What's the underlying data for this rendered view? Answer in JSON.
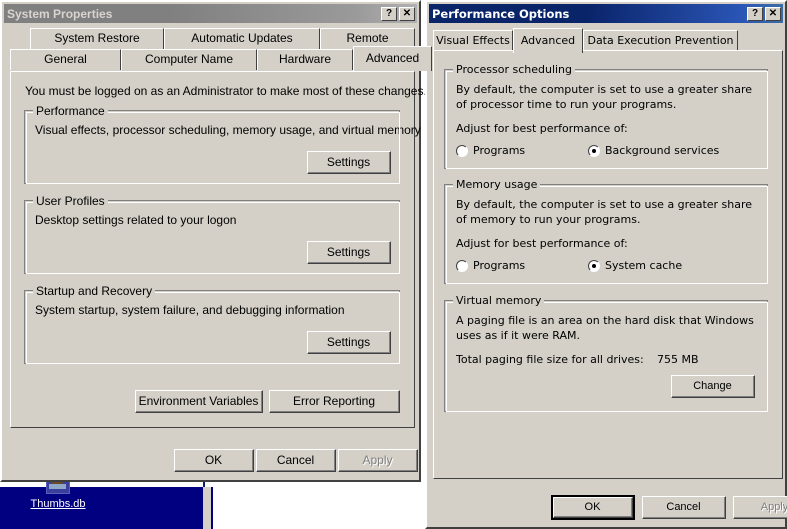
{
  "desktop": {
    "icon": {
      "label": "Thumbs.db",
      "name": "thumbs-db-file-icon"
    }
  },
  "system_properties": {
    "title": "System Properties",
    "active": false,
    "titlebar_buttons": {
      "help": "?",
      "close": "✕"
    },
    "tabs_row1": [
      "System Restore",
      "Automatic Updates",
      "Remote"
    ],
    "tabs_row2": [
      "General",
      "Computer Name",
      "Hardware",
      "Advanced"
    ],
    "selected_tab": "Advanced",
    "admin_notice": "You must be logged on as an Administrator to make most of these changes.",
    "groups": [
      {
        "title": "Performance",
        "description": "Visual effects, processor scheduling, memory usage, and virtual memory",
        "button": "Settings"
      },
      {
        "title": "User Profiles",
        "description": "Desktop settings related to your logon",
        "button": "Settings"
      },
      {
        "title": "Startup and Recovery",
        "description": "System startup, system failure, and debugging information",
        "button": "Settings"
      }
    ],
    "extra_buttons": [
      "Environment Variables",
      "Error Reporting"
    ],
    "footer_buttons": [
      {
        "label": "OK",
        "enabled": true,
        "default": false
      },
      {
        "label": "Cancel",
        "enabled": true,
        "default": false
      },
      {
        "label": "Apply",
        "enabled": false,
        "default": false
      }
    ]
  },
  "performance_options": {
    "title": "Performance Options",
    "active": true,
    "titlebar_buttons": {
      "help": "?",
      "close": "✕"
    },
    "tabs": [
      "Visual Effects",
      "Advanced",
      "Data Execution Prevention"
    ],
    "selected_tab": "Advanced",
    "processor_scheduling": {
      "title": "Processor scheduling",
      "description": "By default, the computer is set to use a greater share of processor time to run your programs.",
      "prompt": "Adjust for best performance of:",
      "options": [
        {
          "label": "Programs",
          "selected": false
        },
        {
          "label": "Background services",
          "selected": true
        }
      ]
    },
    "memory_usage": {
      "title": "Memory usage",
      "description": "By default, the computer is set to use a greater share of memory to run your programs.",
      "prompt": "Adjust for best performance of:",
      "options": [
        {
          "label": "Programs",
          "selected": false
        },
        {
          "label": "System cache",
          "selected": true
        }
      ]
    },
    "virtual_memory": {
      "title": "Virtual memory",
      "description": "A paging file is an area on the hard disk that Windows uses as if it were RAM.",
      "total_label": "Total paging file size for all drives:",
      "total_value": "755 MB",
      "button": "Change"
    },
    "footer_buttons": [
      {
        "label": "OK",
        "enabled": true,
        "default": true
      },
      {
        "label": "Cancel",
        "enabled": true,
        "default": false
      },
      {
        "label": "Apply",
        "enabled": false,
        "default": false
      }
    ]
  },
  "colors": {
    "face": "#d4d0c8",
    "active_title": "#0a246a",
    "inactive_title": "#808080",
    "desktop": "#000080",
    "disabled_text": "#808080"
  }
}
